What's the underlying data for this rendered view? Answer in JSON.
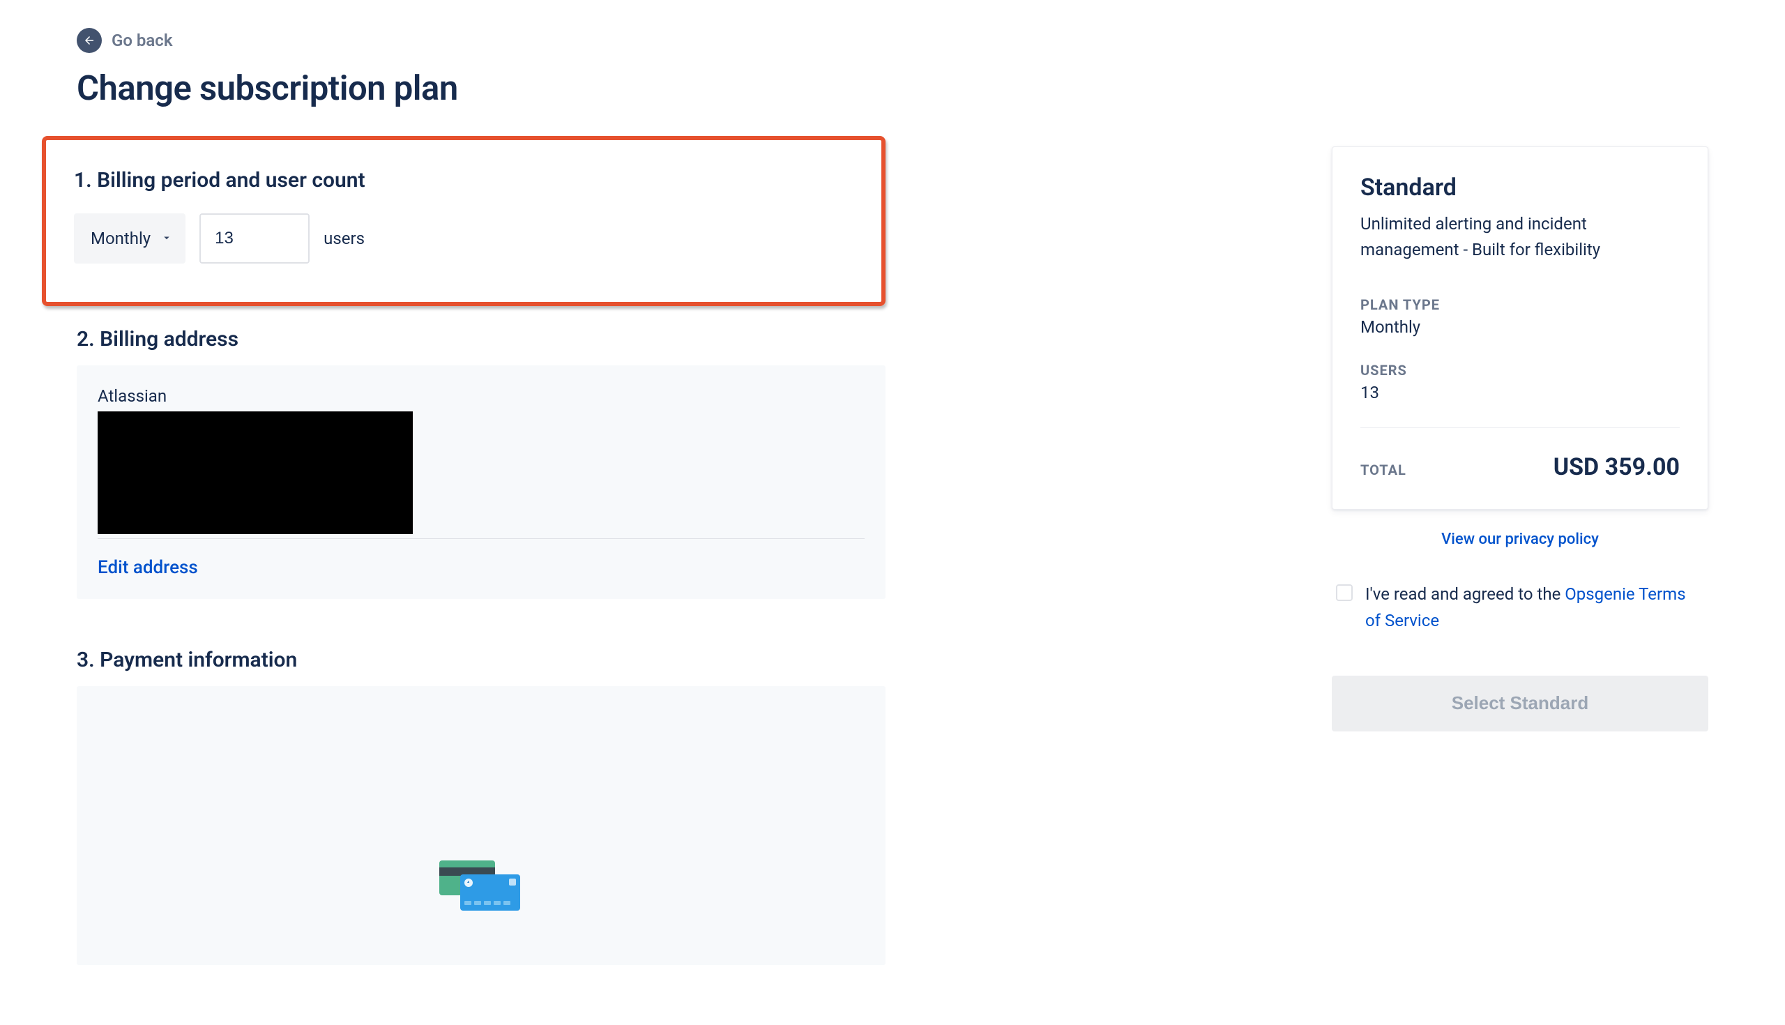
{
  "header": {
    "go_back": "Go back",
    "title": "Change subscription plan"
  },
  "sections": {
    "billing_period": {
      "heading": "1. Billing period and user count",
      "period_selected": "Monthly",
      "user_count": "13",
      "users_suffix": "users"
    },
    "billing_address": {
      "heading": "2. Billing address",
      "company": "Atlassian",
      "edit_link": "Edit address"
    },
    "payment_info": {
      "heading": "3. Payment information"
    }
  },
  "summary": {
    "plan_name": "Standard",
    "plan_desc": "Unlimited alerting and incident management - Built for flexibility",
    "plan_type_label": "PLAN TYPE",
    "plan_type_value": "Monthly",
    "users_label": "USERS",
    "users_value": "13",
    "total_label": "TOTAL",
    "total_value": "USD 359.00",
    "privacy_link": "View our privacy policy",
    "consent_prefix": "I've read and agreed to the ",
    "consent_link": "Opsgenie Terms of Service",
    "select_button": "Select Standard"
  }
}
